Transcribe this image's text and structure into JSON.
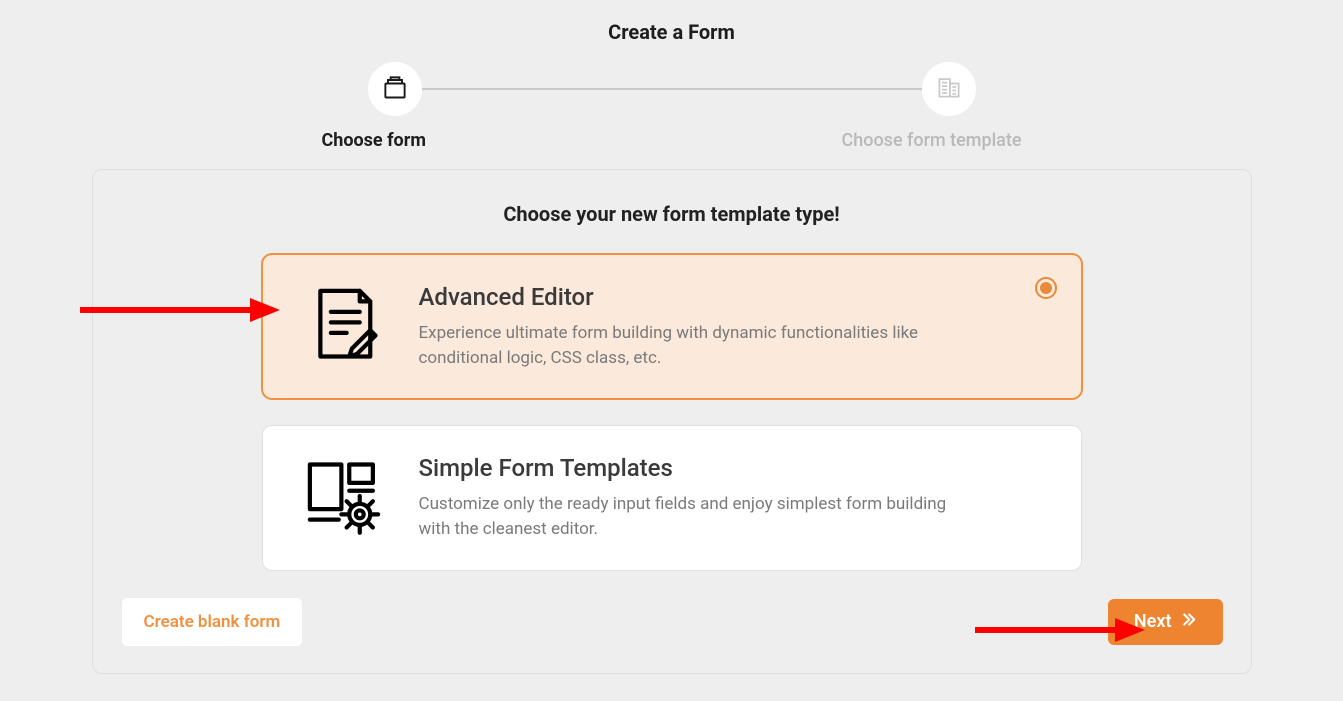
{
  "title": "Create a Form",
  "steps": [
    {
      "label": "Choose form"
    },
    {
      "label": "Choose form template"
    }
  ],
  "panel": {
    "heading": "Choose your new form template type!"
  },
  "options": [
    {
      "title": "Advanced Editor",
      "description": "Experience ultimate form building with dynamic functionalities like conditional logic, CSS class, etc."
    },
    {
      "title": "Simple Form Templates",
      "description": "Customize only the ready input fields and enjoy simplest form building with the cleanest editor."
    }
  ],
  "footer": {
    "blank_label": "Create blank form",
    "next_label": "Next"
  }
}
